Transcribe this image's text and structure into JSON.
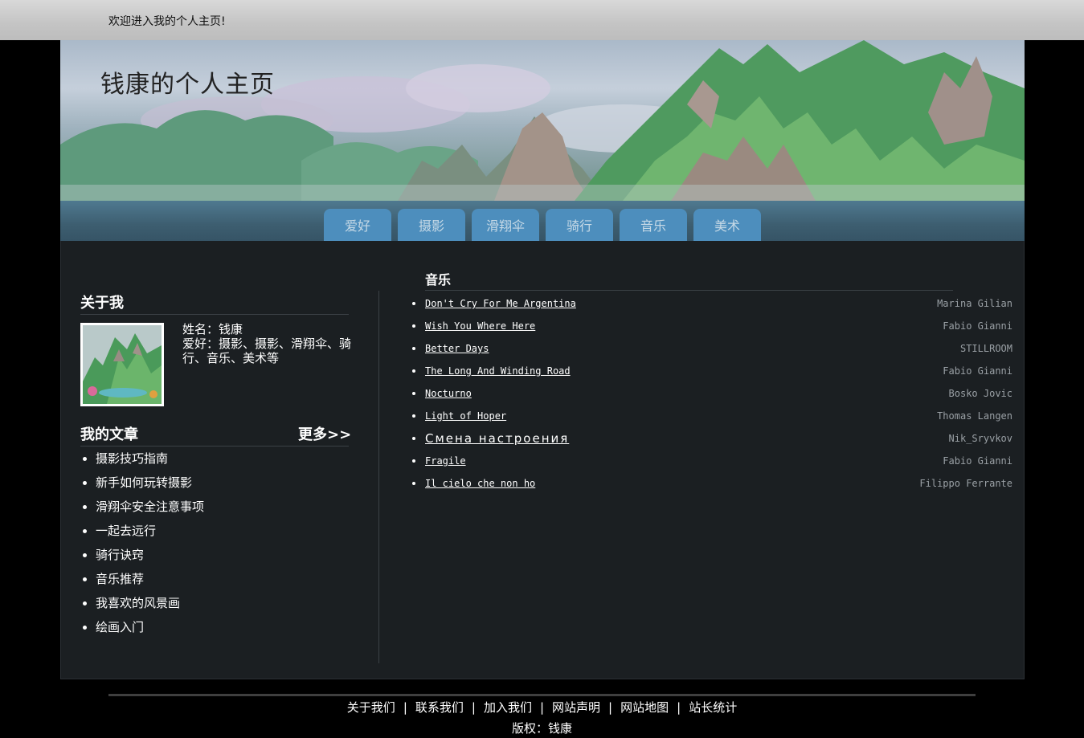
{
  "topbar": {
    "welcome": "欢迎进入我的个人主页!"
  },
  "header": {
    "site_title": "钱康的个人主页"
  },
  "nav": {
    "tabs": [
      "爱好",
      "摄影",
      "滑翔伞",
      "骑行",
      "音乐",
      "美术"
    ]
  },
  "about": {
    "title": "关于我",
    "name_line": "姓名：钱康",
    "hobby_line": "爱好：摄影、摄影、滑翔伞、骑行、音乐、美术等"
  },
  "articles": {
    "title": "我的文章",
    "more": "更多>>",
    "items": [
      "摄影技巧指南",
      "新手如何玩转摄影",
      "滑翔伞安全注意事项",
      "一起去远行",
      "骑行诀窍",
      "音乐推荐",
      "我喜欢的风景画",
      "绘画入门"
    ]
  },
  "music": {
    "title": "音乐",
    "songs": [
      {
        "title": "Don't Cry For Me Argentina",
        "artist": "Marina Gilian"
      },
      {
        "title": "Wish You Where Here",
        "artist": "Fabio Gianni"
      },
      {
        "title": "Better Days",
        "artist": "STILLROOM"
      },
      {
        "title": "The Long And Winding Road",
        "artist": "Fabio Gianni"
      },
      {
        "title": "Nocturno",
        "artist": "Bosko Jovic"
      },
      {
        "title": "Light of Hoper",
        "artist": "Thomas Langen"
      },
      {
        "title": "Смена настроения",
        "artist": "Nik_Sryvkov"
      },
      {
        "title": "Fragile",
        "artist": "Fabio Gianni"
      },
      {
        "title": "Il cielo che non ho",
        "artist": "Filippo Ferrante"
      }
    ]
  },
  "footer": {
    "links": [
      "关于我们",
      "联系我们",
      "加入我们",
      "网站声明",
      "网站地图",
      "站长统计"
    ],
    "separator": "|",
    "copyright": "版权：钱康"
  }
}
